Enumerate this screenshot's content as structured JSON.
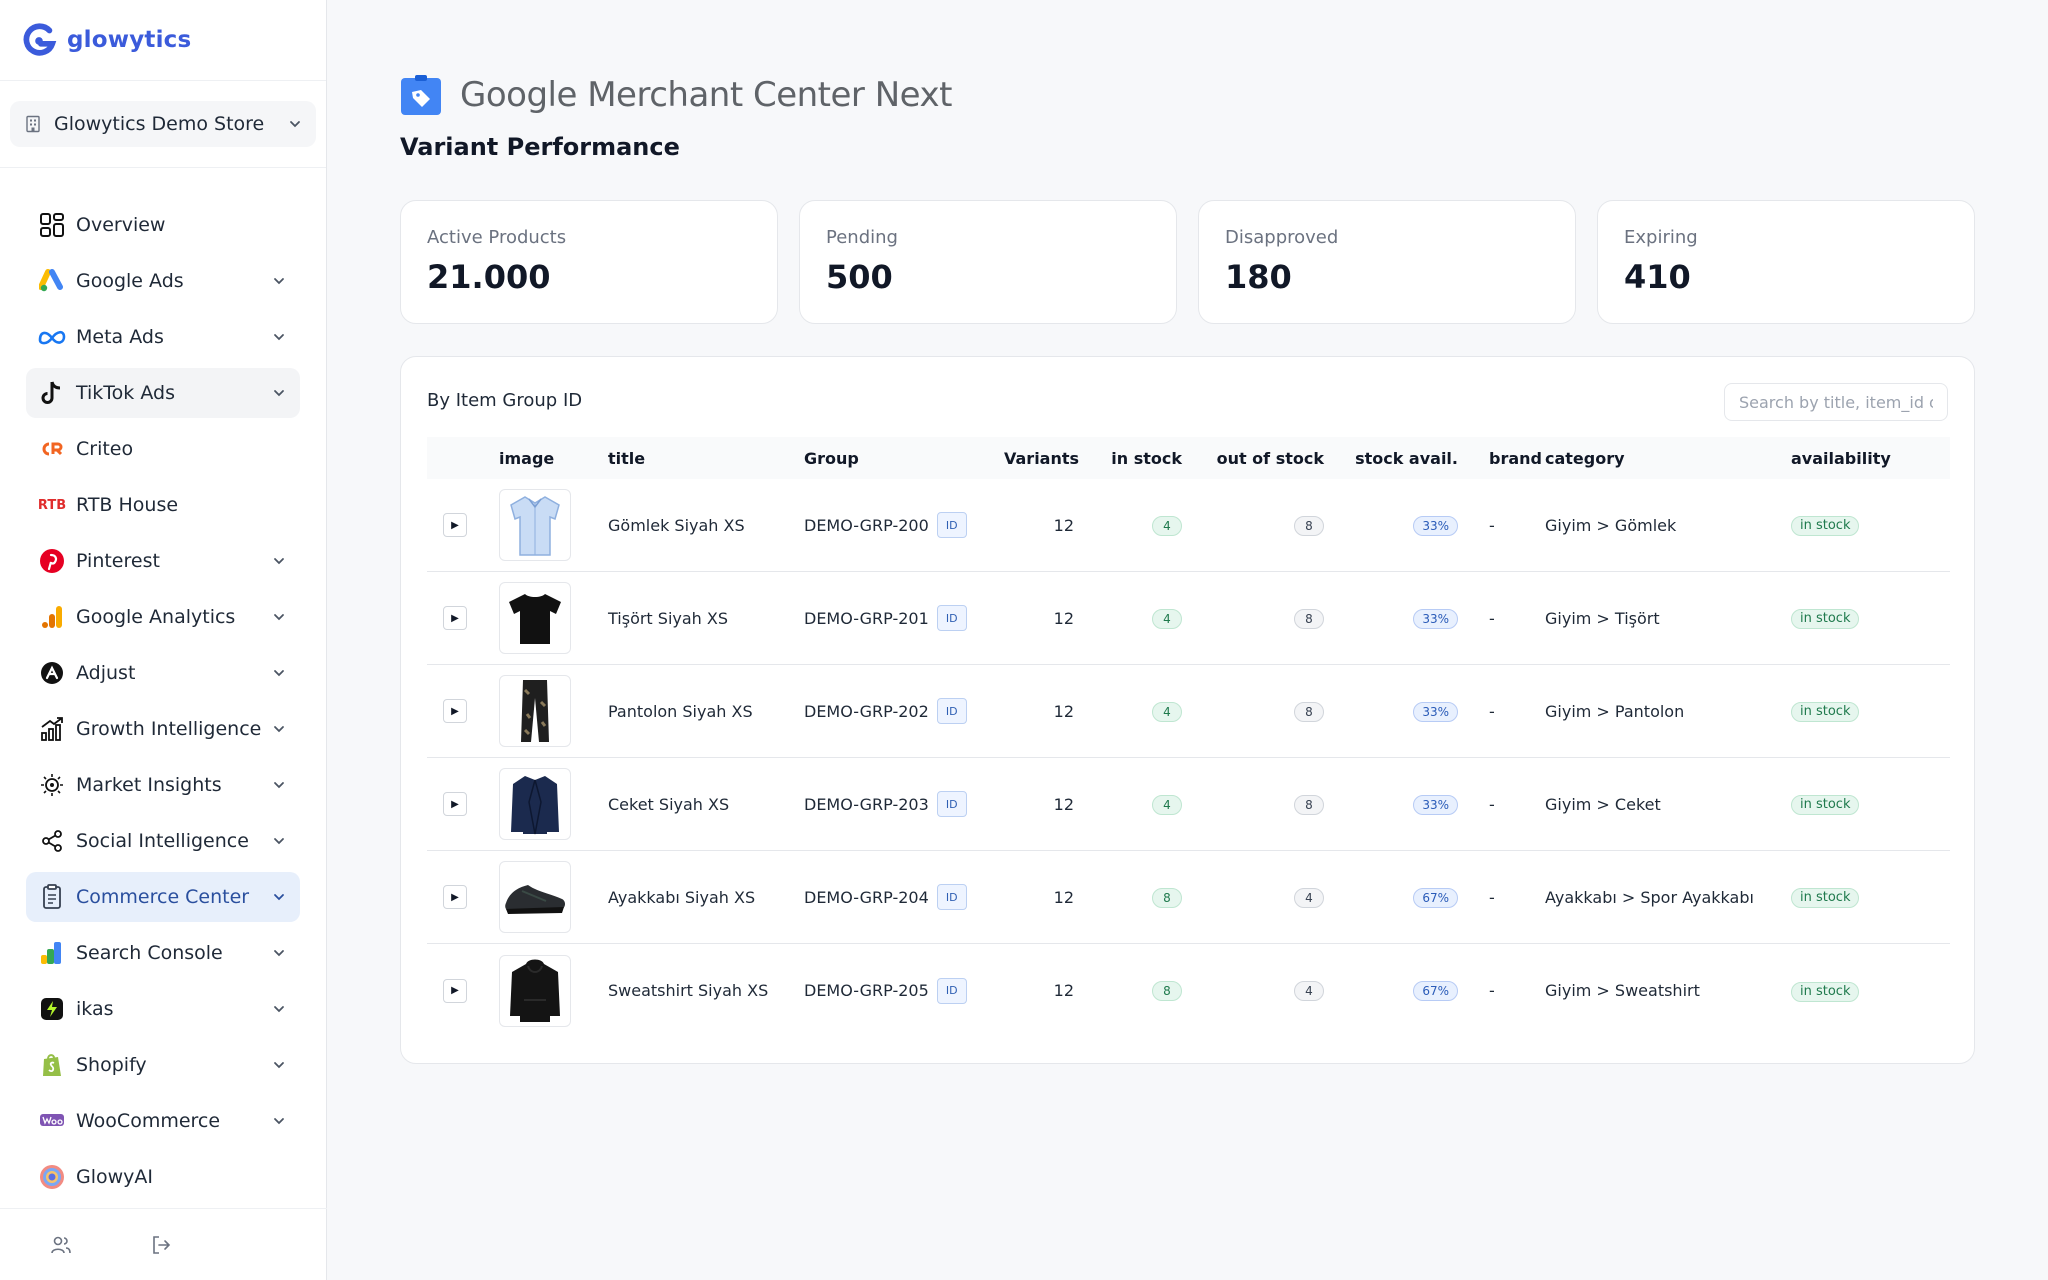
{
  "brand": {
    "name": "glowytics"
  },
  "store": {
    "name": "Glowytics Demo Store"
  },
  "nav": {
    "items": [
      {
        "label": "Overview"
      },
      {
        "label": "Google Ads"
      },
      {
        "label": "Meta Ads"
      },
      {
        "label": "TikTok Ads"
      },
      {
        "label": "Criteo"
      },
      {
        "label": "RTB House"
      },
      {
        "label": "Pinterest"
      },
      {
        "label": "Google Analytics"
      },
      {
        "label": "Adjust"
      },
      {
        "label": "Growth Intelligence"
      },
      {
        "label": "Market Insights"
      },
      {
        "label": "Social Intelligence"
      },
      {
        "label": "Commerce Center"
      },
      {
        "label": "Search Console"
      },
      {
        "label": "ikas"
      },
      {
        "label": "Shopify"
      },
      {
        "label": "WooCommerce"
      },
      {
        "label": "GlowyAI"
      }
    ],
    "active": "Commerce Center",
    "rtb_icon_text": "RTB"
  },
  "header": {
    "gmc_brand": "Google",
    "gmc_product": "Merchant Center Next",
    "page_title": "Variant Performance"
  },
  "stats": [
    {
      "label": "Active Products",
      "value": "21.000"
    },
    {
      "label": "Pending",
      "value": "500"
    },
    {
      "label": "Disapproved",
      "value": "180"
    },
    {
      "label": "Expiring",
      "value": "410"
    }
  ],
  "table": {
    "title": "By Item Group ID",
    "search_placeholder": "Search by title, item_id o",
    "columns": [
      "image",
      "title",
      "Group",
      "Variants",
      "in stock",
      "out of stock",
      "stock avail.",
      "brand",
      "category",
      "availability"
    ],
    "expand_glyph": "▶",
    "id_badge": "ID",
    "rows": [
      {
        "image": "shirt",
        "title": "Gömlek Siyah XS",
        "group": "DEMO-GRP-200",
        "variants": "12",
        "in_stock": "4",
        "out_of_stock": "8",
        "stock_avail": "33%",
        "brand": "-",
        "category": "Giyim > Gömlek",
        "availability": "in stock"
      },
      {
        "image": "tshirt",
        "title": "Tişört Siyah XS",
        "group": "DEMO-GRP-201",
        "variants": "12",
        "in_stock": "4",
        "out_of_stock": "8",
        "stock_avail": "33%",
        "brand": "-",
        "category": "Giyim > Tişört",
        "availability": "in stock"
      },
      {
        "image": "pants",
        "title": "Pantolon Siyah XS",
        "group": "DEMO-GRP-202",
        "variants": "12",
        "in_stock": "4",
        "out_of_stock": "8",
        "stock_avail": "33%",
        "brand": "-",
        "category": "Giyim > Pantolon",
        "availability": "in stock"
      },
      {
        "image": "jacket",
        "title": "Ceket Siyah XS",
        "group": "DEMO-GRP-203",
        "variants": "12",
        "in_stock": "4",
        "out_of_stock": "8",
        "stock_avail": "33%",
        "brand": "-",
        "category": "Giyim > Ceket",
        "availability": "in stock"
      },
      {
        "image": "shoe",
        "title": "Ayakkabı Siyah XS",
        "group": "DEMO-GRP-204",
        "variants": "12",
        "in_stock": "8",
        "out_of_stock": "4",
        "stock_avail": "67%",
        "brand": "-",
        "category": "Ayakkabı > Spor Ayakkabı",
        "availability": "in stock"
      },
      {
        "image": "hoodie",
        "title": "Sweatshirt Siyah XS",
        "group": "DEMO-GRP-205",
        "variants": "12",
        "in_stock": "8",
        "out_of_stock": "4",
        "stock_avail": "67%",
        "brand": "-",
        "category": "Giyim > Sweatshirt",
        "availability": "in stock"
      }
    ]
  },
  "colors": {
    "brand": "#3b5bdb",
    "active_nav_bg": "#e7effb",
    "active_nav_text": "#2a4f9e",
    "pill_green": "#1f7a4d",
    "pill_blue": "#2a5bb8"
  }
}
